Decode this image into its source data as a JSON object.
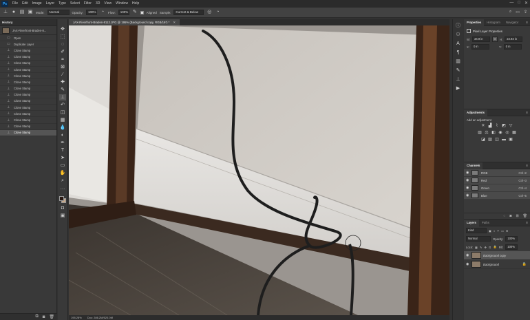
{
  "menubar": {
    "logo": "Ps",
    "items": [
      "File",
      "Edit",
      "Image",
      "Layer",
      "Type",
      "Select",
      "Filter",
      "3D",
      "View",
      "Window",
      "Help"
    ],
    "window_controls": [
      "—",
      "□",
      "✕"
    ]
  },
  "options": {
    "mode_label": "Mode:",
    "mode_value": "Normal",
    "opacity_label": "Opacity:",
    "opacity_value": "100%",
    "flow_label": "Flow:",
    "flow_value": "100%",
    "aligned_label": "Aligned",
    "sample_label": "Sample:",
    "sample_value": "Current & Below"
  },
  "history": {
    "title": "History",
    "snapshot": "JAX-Riverfront-Braden-8...",
    "items": [
      "Open",
      "Duplicate Layer",
      "Clone Stamp",
      "Clone Stamp",
      "Clone Stamp",
      "Clone Stamp",
      "Clone Stamp",
      "Clone Stamp",
      "Clone Stamp",
      "Clone Stamp",
      "Clone Stamp",
      "Clone Stamp",
      "Clone Stamp",
      "Clone Stamp",
      "Clone Stamp",
      "Clone Stamp"
    ],
    "selected_index": 15
  },
  "document": {
    "tab_title": "JAX-Riverfront-Braden-8112.JPG @ 195% (Background copy, RGB/16*) *",
    "zoom": "195.28%",
    "doc_size": "Doc: 286.2M/520.0M"
  },
  "colors": {
    "foreground": "#2a1a14",
    "background": "#c8a98a"
  },
  "properties": {
    "tabs": [
      "Properties",
      "Histogram",
      "Navigator"
    ],
    "title": "Pixel Layer Properties",
    "w_label": "W:",
    "w_value": "34.9 in",
    "h_label": "H:",
    "h_value": "22.93 in",
    "x_label": "X:",
    "x_value": "0 in",
    "y_label": "Y:",
    "y_value": "0 in"
  },
  "adjustments": {
    "title": "Adjustments",
    "add_label": "Add an adjustment"
  },
  "channels": {
    "title": "Channels",
    "rows": [
      {
        "name": "RGB",
        "key": "Ctrl+2"
      },
      {
        "name": "Red",
        "key": "Ctrl+3"
      },
      {
        "name": "Green",
        "key": "Ctrl+4"
      },
      {
        "name": "Blue",
        "key": "Ctrl+5"
      }
    ]
  },
  "layers": {
    "tabs": [
      "Layers",
      "Paths"
    ],
    "filter_value": "Kind",
    "blend_value": "Normal",
    "opacity_label": "Opacity:",
    "opacity_value": "100%",
    "lock_label": "Lock:",
    "fill_label": "Fill:",
    "fill_value": "100%",
    "rows": [
      {
        "name": "Background copy",
        "selected": true
      },
      {
        "name": "Background",
        "selected": false
      }
    ]
  }
}
